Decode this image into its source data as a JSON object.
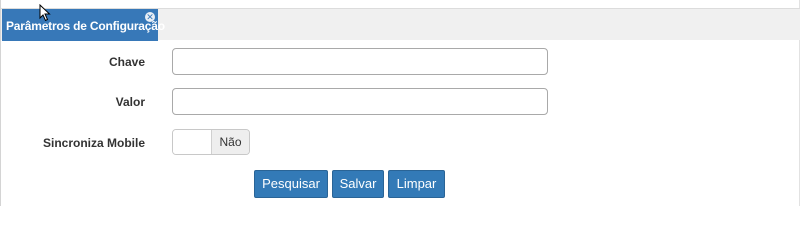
{
  "tab": {
    "title": "Parâmetros de Configuração",
    "close_icon": "close-icon"
  },
  "form": {
    "chave": {
      "label": "Chave",
      "value": "",
      "placeholder": ""
    },
    "valor": {
      "label": "Valor",
      "value": "",
      "placeholder": ""
    },
    "sincroniza_mobile": {
      "label": "Sincroniza Mobile",
      "state_label": "Não",
      "checked": false
    }
  },
  "actions": {
    "pesquisar_label": "Pesquisar",
    "salvar_label": "Salvar",
    "limpar_label": "Limpar"
  },
  "colors": {
    "accent": "#337ab7",
    "tab_bg": "#3778b8"
  }
}
